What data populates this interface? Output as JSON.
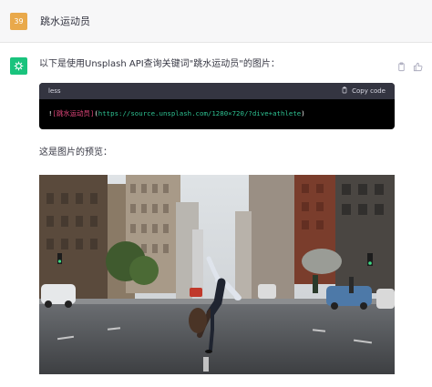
{
  "user": {
    "avatar_text": "39",
    "message": "跳水运动员"
  },
  "assistant": {
    "intro": "以下是使用Unsplash API查询关键词\"跳水运动员\"的图片：",
    "code_block": {
      "language": "less",
      "copy_label": "Copy code",
      "bang": "!",
      "alt": "[跳水运动员]",
      "open_paren": "(",
      "url": "https://source.unsplash.com/1280×720/?dive+athlete",
      "close_paren": ")"
    },
    "preview_label": "这是图片的预览："
  },
  "icons": {
    "copy": "clipboard-icon",
    "thumbs_up": "thumbs-up-icon",
    "logo": "openai-logo-icon"
  },
  "colors": {
    "user_avatar": "#e9a94b",
    "gpt_logo": "#19c37d",
    "code_bg": "#000000",
    "code_header": "#343541"
  }
}
